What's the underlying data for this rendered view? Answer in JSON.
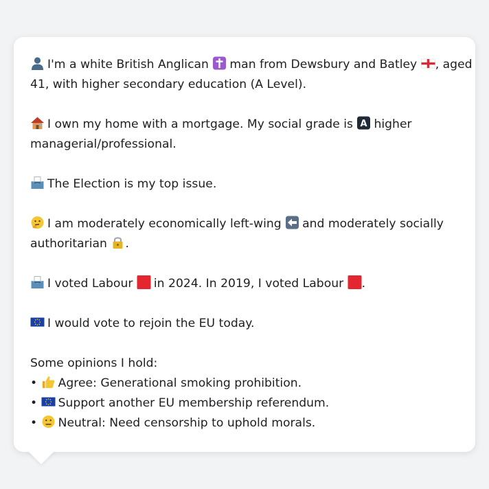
{
  "profile": {
    "line1_a": "I'm a white British Anglican",
    "line1_b": "man from Dewsbury and Batley",
    "line1_c": ", aged",
    "line2": "41, with higher secondary education (A Level).",
    "home_a": "I own my home with a mortgage. My social grade is",
    "home_b": "higher",
    "home_c": "managerial/professional.",
    "issue": "The Election is my top issue.",
    "ideology_a": "I am moderately economically left-wing",
    "ideology_b": "and moderately socially",
    "ideology_c": "authoritarian",
    "ideology_d": ".",
    "vote_a": "I voted Labour",
    "vote_b": "in 2024. In 2019, I voted Labour",
    "vote_c": ".",
    "eu": "I would vote to rejoin the EU today."
  },
  "opinions": {
    "heading": "Some opinions I hold:",
    "bullet": "•",
    "items": [
      {
        "text": "Agree: Generational smoking prohibition.",
        "icon": "thumbs-up-icon"
      },
      {
        "text": "Support another EU membership referendum.",
        "icon": "eu-flag-icon"
      },
      {
        "text": "Neutral: Need censorship to uphold morals.",
        "icon": "neutral-face-icon"
      }
    ]
  },
  "icons": {
    "person": "person-silhouette-icon",
    "cross": "latin-cross-icon",
    "england_flag": "england-flag-icon",
    "house": "house-icon",
    "grade_a": "letter-a-button-icon",
    "ballot": "ballot-box-icon",
    "thinking": "thinking-face-icon",
    "left_arrow": "left-arrow-icon",
    "lock": "lock-icon",
    "labour_square": "red-square-icon",
    "eu_flag": "eu-flag-icon"
  },
  "colors": {
    "background": "#f2f3f5",
    "bubble": "#ffffff",
    "text": "#1d1f23",
    "labour_red": "#e3262f",
    "eu_blue": "#1a3fa6",
    "cross_purple": "#9b59d0"
  }
}
